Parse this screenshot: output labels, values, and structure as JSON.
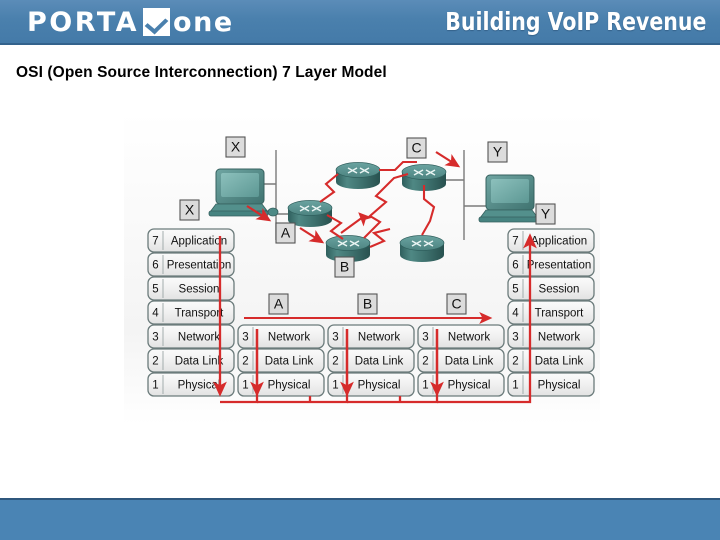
{
  "header": {
    "logo_part1": "PORTA",
    "logo_mark": "check-mark",
    "logo_part2": "one",
    "tagline": "Building VoIP Revenue",
    "bar_color": "#4a80ad"
  },
  "slide": {
    "title": "OSI (Open Source Interconnection) 7 Layer Model"
  },
  "diagram": {
    "accent_color": "#e03232",
    "device_color": "#4f8c8c",
    "box_fill": "#f2f2f2",
    "box_border": "#6b7b7b",
    "topology": {
      "host_left": {
        "label": "X",
        "type": "computer"
      },
      "host_right": {
        "label": "Y",
        "type": "computer"
      },
      "routers": [
        {
          "id": "r_left",
          "label": "A"
        },
        {
          "id": "r_top",
          "label": ""
        },
        {
          "id": "r_bottom",
          "label": "B"
        },
        {
          "id": "r_right",
          "label": "C"
        },
        {
          "id": "r_lower",
          "label": ""
        }
      ],
      "router_labels": [
        "A",
        "B",
        "C"
      ]
    },
    "path_labels": [
      "A",
      "B",
      "C"
    ],
    "stack_labels": {
      "left": "X",
      "right": "Y"
    },
    "full_stack": [
      {
        "num": "7",
        "name": "Application"
      },
      {
        "num": "6",
        "name": "Presentation"
      },
      {
        "num": "5",
        "name": "Session"
      },
      {
        "num": "4",
        "name": "Transport"
      },
      {
        "num": "3",
        "name": "Network"
      },
      {
        "num": "2",
        "name": "Data Link"
      },
      {
        "num": "1",
        "name": "Physical"
      }
    ],
    "router_stack": [
      {
        "num": "3",
        "name": "Network"
      },
      {
        "num": "2",
        "name": "Data Link"
      },
      {
        "num": "1",
        "name": "Physical"
      }
    ],
    "stacks": [
      {
        "id": "stack-x",
        "kind": "full"
      },
      {
        "id": "stack-a",
        "kind": "router"
      },
      {
        "id": "stack-b",
        "kind": "router"
      },
      {
        "id": "stack-c",
        "kind": "router"
      },
      {
        "id": "stack-y",
        "kind": "full"
      }
    ]
  },
  "footer": {
    "bar_color": "#4a84b4"
  }
}
